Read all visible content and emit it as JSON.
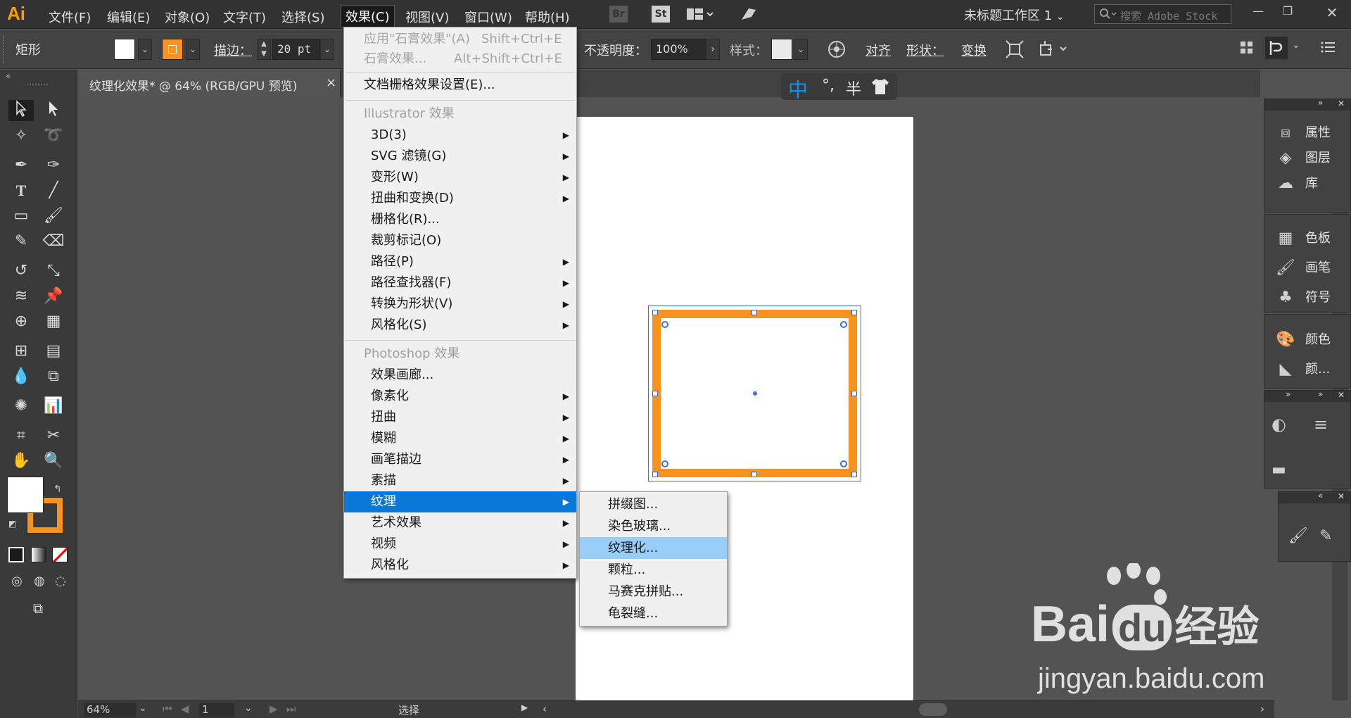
{
  "app": {
    "logo": "Ai",
    "workspace": "未标题工作区 1",
    "search_placeholder": "搜索 Adobe Stock"
  },
  "menubar": {
    "items": [
      "文件(F)",
      "编辑(E)",
      "对象(O)",
      "文字(T)",
      "选择(S)",
      "效果(C)",
      "视图(V)",
      "窗口(W)",
      "帮助(H)"
    ],
    "active": "效果(C)",
    "bridge_icons": [
      "Br",
      "St"
    ]
  },
  "control_bar": {
    "object_type": "矩形",
    "stroke_label": "描边",
    "stroke_value": "20 pt",
    "opacity_label": "不透明度",
    "opacity_value": "100%",
    "style_label": "样式",
    "align_label": "对齐",
    "shape_label": "形状",
    "transform_label": "变换",
    "colors": {
      "fill": "#ffffff",
      "stroke": "#f7931e"
    }
  },
  "document": {
    "tab_title": "纹理化效果* @ 64% (RGB/GPU 预览)",
    "close": "×"
  },
  "ime": {
    "lang": "中",
    "punct": "°,",
    "width": "半"
  },
  "status": {
    "zoom": "64%",
    "artboard": "1",
    "tool_name": "选择"
  },
  "effect_menu": {
    "items": [
      {
        "label": "应用\"石膏效果\"(A)",
        "shortcut": "Shift+Ctrl+E",
        "disabled": true
      },
      {
        "label": "石膏效果...",
        "shortcut": "Alt+Shift+Ctrl+E",
        "disabled": true
      },
      {
        "label": "文档栅格效果设置(E)..."
      },
      {
        "label": "Illustrator 效果",
        "header": true
      },
      {
        "label": "3D(3)",
        "submenu": true
      },
      {
        "label": "SVG 滤镜(G)",
        "submenu": true
      },
      {
        "label": "变形(W)",
        "submenu": true
      },
      {
        "label": "扭曲和变换(D)",
        "submenu": true
      },
      {
        "label": "栅格化(R)..."
      },
      {
        "label": "裁剪标记(O)"
      },
      {
        "label": "路径(P)",
        "submenu": true
      },
      {
        "label": "路径查找器(F)",
        "submenu": true
      },
      {
        "label": "转换为形状(V)",
        "submenu": true
      },
      {
        "label": "风格化(S)",
        "submenu": true
      },
      {
        "label": "Photoshop 效果",
        "header": true
      },
      {
        "label": "效果画廊..."
      },
      {
        "label": "像素化",
        "submenu": true
      },
      {
        "label": "扭曲",
        "submenu": true
      },
      {
        "label": "模糊",
        "submenu": true
      },
      {
        "label": "画笔描边",
        "submenu": true
      },
      {
        "label": "素描",
        "submenu": true
      },
      {
        "label": "纹理",
        "submenu": true,
        "highlighted": true
      },
      {
        "label": "艺术效果",
        "submenu": true
      },
      {
        "label": "视频",
        "submenu": true
      },
      {
        "label": "风格化",
        "submenu": true
      }
    ]
  },
  "texture_submenu": {
    "items": [
      "拼缀图...",
      "染色玻璃...",
      "纹理化...",
      "颗粒...",
      "马赛克拼贴...",
      "龟裂缝..."
    ],
    "highlighted": "纹理化..."
  },
  "right_panels": {
    "group1": [
      "属性",
      "图层",
      "库"
    ],
    "group2": [
      "色板",
      "画笔",
      "符号"
    ],
    "group3": [
      "颜色",
      "颜..."
    ]
  },
  "watermark": {
    "brand": "Bai",
    "brand2": "du",
    "suffix": "经验",
    "url": "jingyan.baidu.com"
  }
}
